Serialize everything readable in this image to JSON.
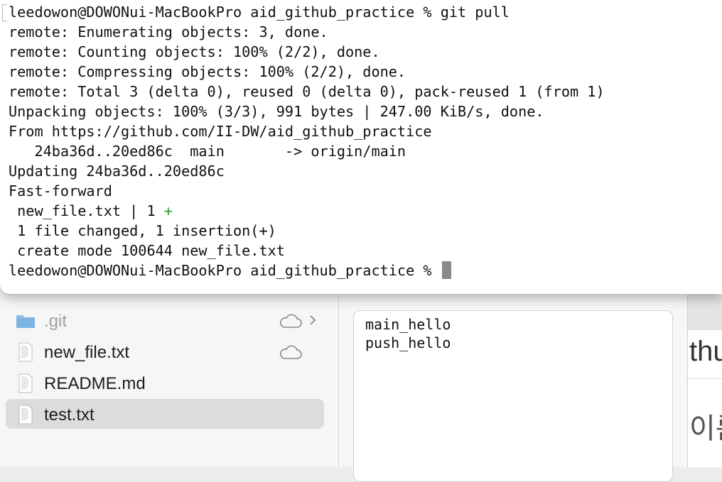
{
  "terminal": {
    "lines": [
      "leedowon@DOWONui-MacBookPro aid_github_practice % git pull",
      "remote: Enumerating objects: 3, done.",
      "remote: Counting objects: 100% (2/2), done.",
      "remote: Compressing objects: 100% (2/2), done.",
      "remote: Total 3 (delta 0), reused 0 (delta 0), pack-reused 1 (from 1)",
      "Unpacking objects: 100% (3/3), 991 bytes | 247.00 KiB/s, done.",
      "From https://github.com/II-DW/aid_github_practice",
      "   24ba36d..20ed86c  main       -> origin/main",
      "Updating 24ba36d..20ed86c",
      "Fast-forward",
      " new_file.txt | 1 ",
      " 1 file changed, 1 insertion(+)",
      " create mode 100644 new_file.txt"
    ],
    "diffstat_plus": "+",
    "prompt": "leedowon@DOWONui-MacBookPro aid_github_practice % "
  },
  "finder": {
    "files": [
      {
        "name": ".git",
        "icon": "folder-icon"
      },
      {
        "name": "new_file.txt",
        "icon": "text-file-icon"
      },
      {
        "name": "README.md",
        "icon": "text-file-icon"
      },
      {
        "name": "test.txt",
        "icon": "text-file-icon"
      }
    ]
  },
  "preview": {
    "lines": [
      "main_hello",
      "push_hello"
    ]
  },
  "browser_clip": {
    "text_top": "thu",
    "text_bottom": "이름"
  },
  "colors": {
    "selected_row": "#dcdcdc",
    "diff_plus": "#2e9d2e",
    "folder": "#7eb4e3"
  }
}
